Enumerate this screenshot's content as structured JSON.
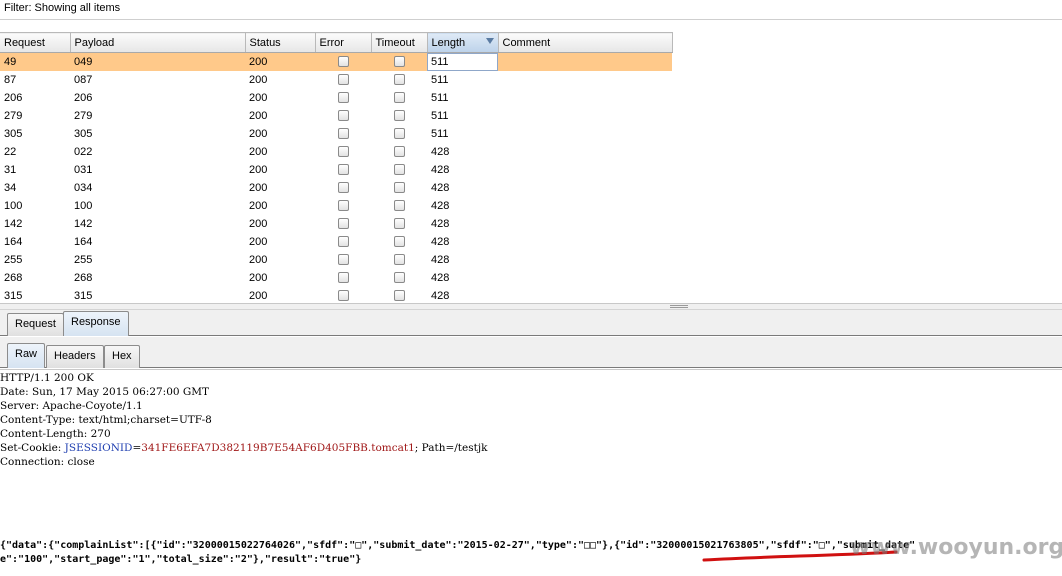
{
  "filter": {
    "text": "Filter:  Showing all items"
  },
  "table": {
    "columns": [
      "Request",
      "Payload",
      "Status",
      "Error",
      "Timeout",
      "Length",
      "Comment"
    ],
    "rows": [
      {
        "request": "49",
        "payload": "049",
        "status": "200",
        "length": "511",
        "selected": true
      },
      {
        "request": "87",
        "payload": "087",
        "status": "200",
        "length": "511"
      },
      {
        "request": "206",
        "payload": "206",
        "status": "200",
        "length": "511"
      },
      {
        "request": "279",
        "payload": "279",
        "status": "200",
        "length": "511"
      },
      {
        "request": "305",
        "payload": "305",
        "status": "200",
        "length": "511"
      },
      {
        "request": "22",
        "payload": "022",
        "status": "200",
        "length": "428"
      },
      {
        "request": "31",
        "payload": "031",
        "status": "200",
        "length": "428"
      },
      {
        "request": "34",
        "payload": "034",
        "status": "200",
        "length": "428"
      },
      {
        "request": "100",
        "payload": "100",
        "status": "200",
        "length": "428"
      },
      {
        "request": "142",
        "payload": "142",
        "status": "200",
        "length": "428"
      },
      {
        "request": "164",
        "payload": "164",
        "status": "200",
        "length": "428"
      },
      {
        "request": "255",
        "payload": "255",
        "status": "200",
        "length": "428"
      },
      {
        "request": "268",
        "payload": "268",
        "status": "200",
        "length": "428"
      },
      {
        "request": "315",
        "payload": "315",
        "status": "200",
        "length": "428"
      }
    ]
  },
  "tabs": {
    "request": "Request",
    "response": "Response"
  },
  "subtabs": {
    "raw": "Raw",
    "headers": "Headers",
    "hex": "Hex"
  },
  "response": {
    "lines": [
      "HTTP/1.1 200 OK",
      "Date: Sun, 17 May 2015 06:27:00 GMT",
      "Server: Apache-Coyote/1.1",
      "Content-Type: text/html;charset=UTF-8",
      "Content-Length: 270"
    ],
    "cookie_prefix": "Set-Cookie: ",
    "cookie_name": "JSESSIONID",
    "cookie_eq": "=",
    "cookie_value": "341FE6EFA7D382119B7E54AF6D405FBB.tomcat1",
    "cookie_suffix": "; Path=/testjk",
    "connection": "Connection: close",
    "json_line1": "{\"data\":{\"complainList\":[{\"id\":\"32000015022764026\",\"sfdf\":\"□\",\"submit_date\":\"2015-02-27\",\"type\":\"□□\"},{\"id\":\"32000015021763805\",\"sfdf\":\"□\",\"submit_date\"",
    "json_line2": "e\":\"100\",\"start_page\":\"1\",\"total_size\":\"2\"},\"result\":\"true\"}"
  },
  "watermark": "www.wooyun.org",
  "colors": {
    "selected_row": "#ffc98a",
    "sorted_header": "#bcd2ea",
    "underline": "#d01010"
  }
}
